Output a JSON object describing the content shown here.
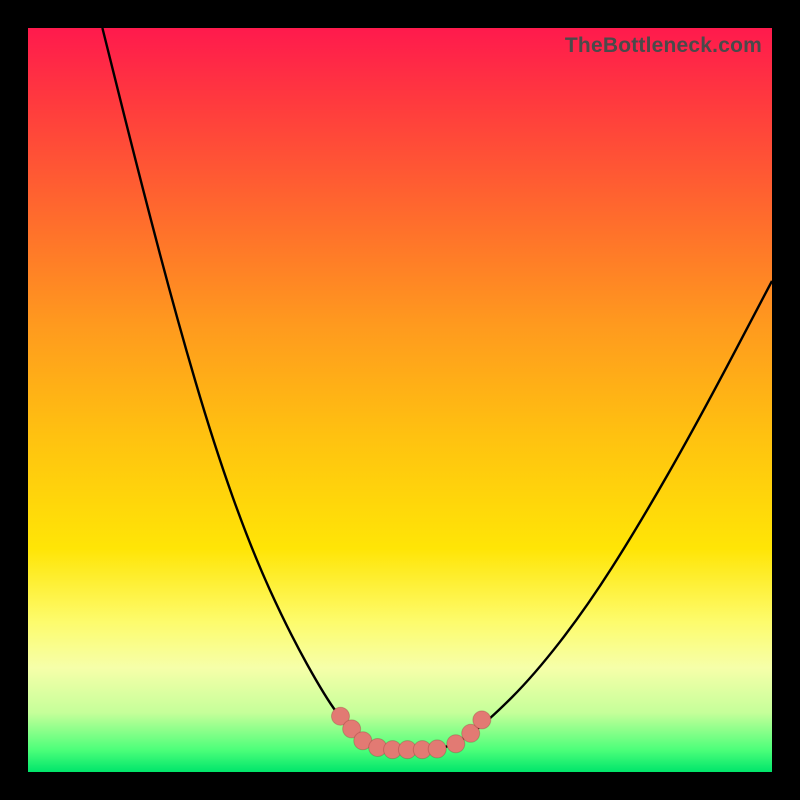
{
  "watermark": "TheBottleneck.com",
  "chart_data": {
    "type": "line",
    "title": "",
    "xlabel": "",
    "ylabel": "",
    "xlim": [
      0,
      100
    ],
    "ylim": [
      0,
      100
    ],
    "grid": false,
    "legend": false,
    "series": [
      {
        "name": "left-branch",
        "x": [
          10,
          15,
          20,
          25,
          30,
          35,
          40,
          43,
          45,
          47,
          50
        ],
        "values": [
          100,
          80,
          61,
          44,
          30,
          19,
          10,
          6,
          4,
          3,
          3
        ]
      },
      {
        "name": "right-branch",
        "x": [
          50,
          55,
          58,
          62,
          68,
          75,
          82,
          90,
          100
        ],
        "values": [
          3,
          3,
          4,
          7,
          13,
          22,
          33,
          47,
          66
        ]
      }
    ],
    "markers": {
      "name": "highlight-points",
      "x": [
        42,
        43.5,
        45,
        47,
        49,
        51,
        53,
        55,
        57.5,
        59.5,
        61
      ],
      "values": [
        7.5,
        5.8,
        4.2,
        3.3,
        3.0,
        3.0,
        3.0,
        3.1,
        3.8,
        5.2,
        7.0
      ]
    },
    "background": {
      "type": "vertical-gradient",
      "stops": [
        {
          "pos": 0,
          "color": "#ff1a4d"
        },
        {
          "pos": 25,
          "color": "#ff6a2d"
        },
        {
          "pos": 55,
          "color": "#ffc210"
        },
        {
          "pos": 80,
          "color": "#fdfc6e"
        },
        {
          "pos": 100,
          "color": "#00e56b"
        }
      ]
    }
  }
}
